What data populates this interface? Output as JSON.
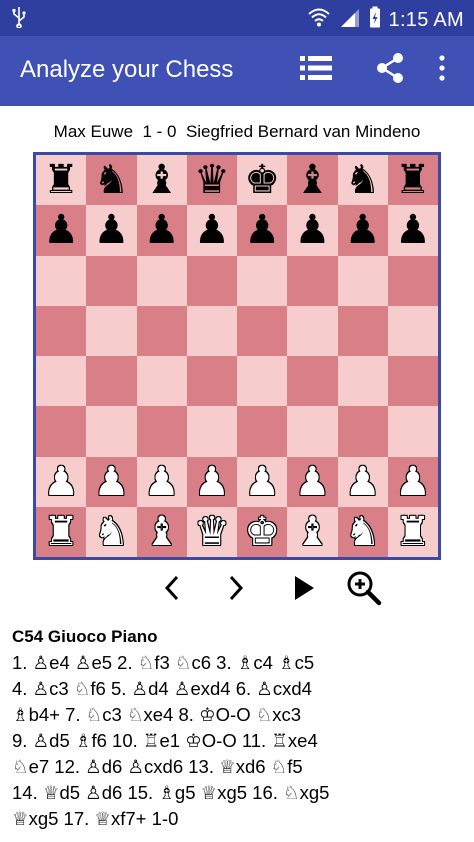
{
  "status_bar": {
    "usb_icon": "usb-icon",
    "icons": [
      "wifi-icon",
      "signal-icon",
      "battery-icon"
    ],
    "time": "1:15 AM"
  },
  "app_bar": {
    "title": "Analyze your Chess",
    "actions": [
      "list-icon",
      "share-icon",
      "overflow-menu-icon"
    ]
  },
  "game": {
    "white": "Max Euwe",
    "result": "1 - 0",
    "black": "Siegfried Bernard van Mindeno",
    "header": "Max Euwe  1 - 0  Siegfried Bernard van Mindeno"
  },
  "board": {
    "ranks": [
      [
        "bR",
        "bN",
        "bB",
        "bQ",
        "bK",
        "bB",
        "bN",
        "bR"
      ],
      [
        "bP",
        "bP",
        "bP",
        "bP",
        "bP",
        "bP",
        "bP",
        "bP"
      ],
      [
        "",
        "",
        "",
        "",
        "",
        "",
        "",
        ""
      ],
      [
        "",
        "",
        "",
        "",
        "",
        "",
        "",
        ""
      ],
      [
        "",
        "",
        "",
        "",
        "",
        "",
        "",
        ""
      ],
      [
        "",
        "",
        "",
        "",
        "",
        "",
        "",
        ""
      ],
      [
        "wP",
        "wP",
        "wP",
        "wP",
        "wP",
        "wP",
        "wP",
        "wP"
      ],
      [
        "wR",
        "wN",
        "wB",
        "wQ",
        "wK",
        "wB",
        "wN",
        "wR"
      ]
    ],
    "colors": {
      "light": "#f6cccc",
      "dark": "#d87f87",
      "border": "#3a4aa6"
    }
  },
  "navigation": {
    "prev": "chevron-left-icon",
    "next": "chevron-right-icon",
    "play": "play-icon",
    "zoom": "zoom-in-icon"
  },
  "moves": {
    "opening": "C54 Giuoco Piano",
    "lines": [
      "1. ♙e4  ♙e5  2. ♘f3  ♘c6  3. ♗c4  ♗c5",
      "4. ♙c3  ♘f6  5. ♙d4  ♙exd4  6. ♙cxd4",
      "♗b4+  7. ♘c3  ♘xe4  8. ♔O-O  ♘xc3",
      "9. ♙d5  ♗f6  10. ♖e1  ♔O-O  11. ♖xe4",
      "♘e7  12. ♙d6  ♙cxd6  13. ♕xd6  ♘f5",
      "14. ♕d5  ♙d6  15. ♗g5  ♕xg5  16. ♘xg5",
      "♕xg5  17. ♕xf7+  1-0"
    ]
  },
  "theme": {
    "primary": "#3f51b5",
    "primary_dark": "#2f3f9f"
  }
}
